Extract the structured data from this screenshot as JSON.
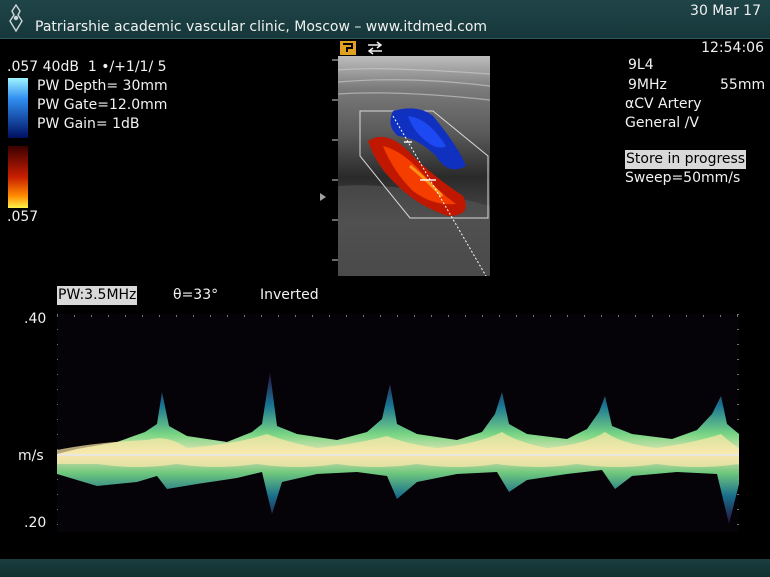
{
  "header": {
    "clinic": "Patriarshie academic vascular clinic, Moscow – www.itdmed.com",
    "date": "30 Mar 17",
    "time": "12:54:06"
  },
  "left_panel": {
    "line1_scale": ".057",
    "line1_gain": "40dB",
    "line1_persist": "1 •/+1/1/ 5",
    "depth": "PW Depth=  30mm",
    "gate": "PW Gate=12.0mm",
    "gain": "PW Gain=    1dB",
    "scale_bottom": ".057"
  },
  "right_panel": {
    "probe": "9L4",
    "freq": "9MHz",
    "depth": "55mm",
    "preset": "αCV Artery",
    "mode": "General /V",
    "store": "Store in progress",
    "sweep": "Sweep=50mm/s"
  },
  "spectral_header": {
    "pw": "PW:3.5MHz",
    "angle": "θ=33°",
    "inverted": "Inverted"
  },
  "spectral_axis": {
    "top": ".40",
    "unit": "m/s",
    "bottom": ".20"
  },
  "colors": {
    "topbar": "#1f4448",
    "background": "#000000"
  },
  "icons": {
    "toolbar_1": "freeze-icon",
    "toolbar_2": "swap-icon"
  }
}
